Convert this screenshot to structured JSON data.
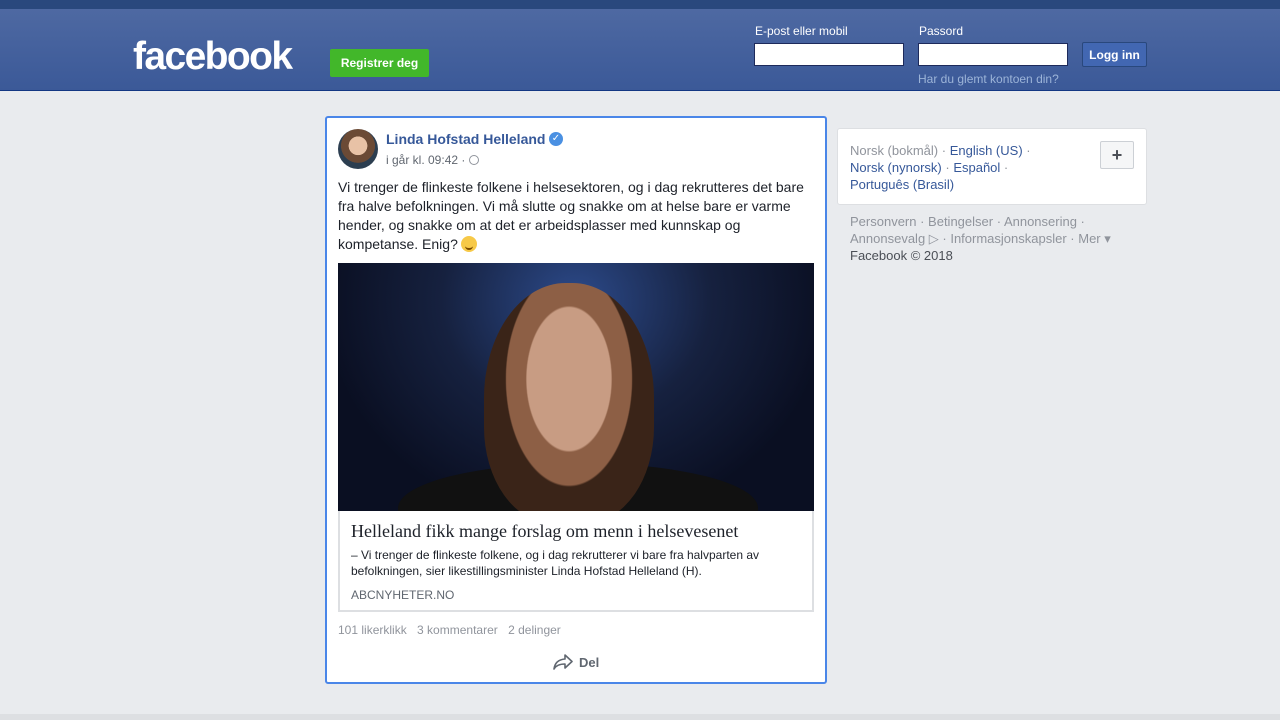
{
  "header": {
    "logo": "facebook",
    "register_label": "Registrer deg",
    "email_label": "E-post eller mobil",
    "password_label": "Passord",
    "login_label": "Logg inn",
    "forgot_label": "Har du glemt kontoen din?"
  },
  "post": {
    "author": "Linda Hofstad Helleland",
    "verified_icon": "✓",
    "timestamp": "i går kl. 09:42 ·",
    "text": "Vi trenger de flinkeste folkene i helsesektoren, og i dag rekrutteres det bare fra halve befolkningen. Vi må slutte og snakke om at helse bare er varme hender, og snakke om at det er arbeidsplasser med kunnskap og kompetanse. Enig?",
    "link": {
      "title": "Helleland fikk mange forslag om menn i helsevesenet",
      "description": "– Vi trenger de flinkeste folkene, og i dag rekrutterer vi bare fra halvparten av befolkningen, sier likestillingsminister Linda Hofstad Helleland (H).",
      "domain": "ABCNYHETER.NO"
    },
    "stats": {
      "likes": "101 likerklikk",
      "comments": "3 kommentarer",
      "shares": "2 delinger"
    },
    "share_label": "Del"
  },
  "languages": {
    "current": "Norsk (bokmål)",
    "options": [
      "English (US)",
      "Norsk (nynorsk)",
      "Español",
      "Português (Brasil)"
    ],
    "plus": "+"
  },
  "footer": {
    "links": [
      "Personvern",
      "Betingelser",
      "Annonsering",
      "Annonsevalg",
      "Informasjonskapsler",
      "Mer"
    ],
    "copyright": "Facebook © 2018"
  },
  "colors": {
    "brand": "#3b5998",
    "register": "#42b72a",
    "link": "#365899",
    "highlight_border": "#4a86e8"
  }
}
